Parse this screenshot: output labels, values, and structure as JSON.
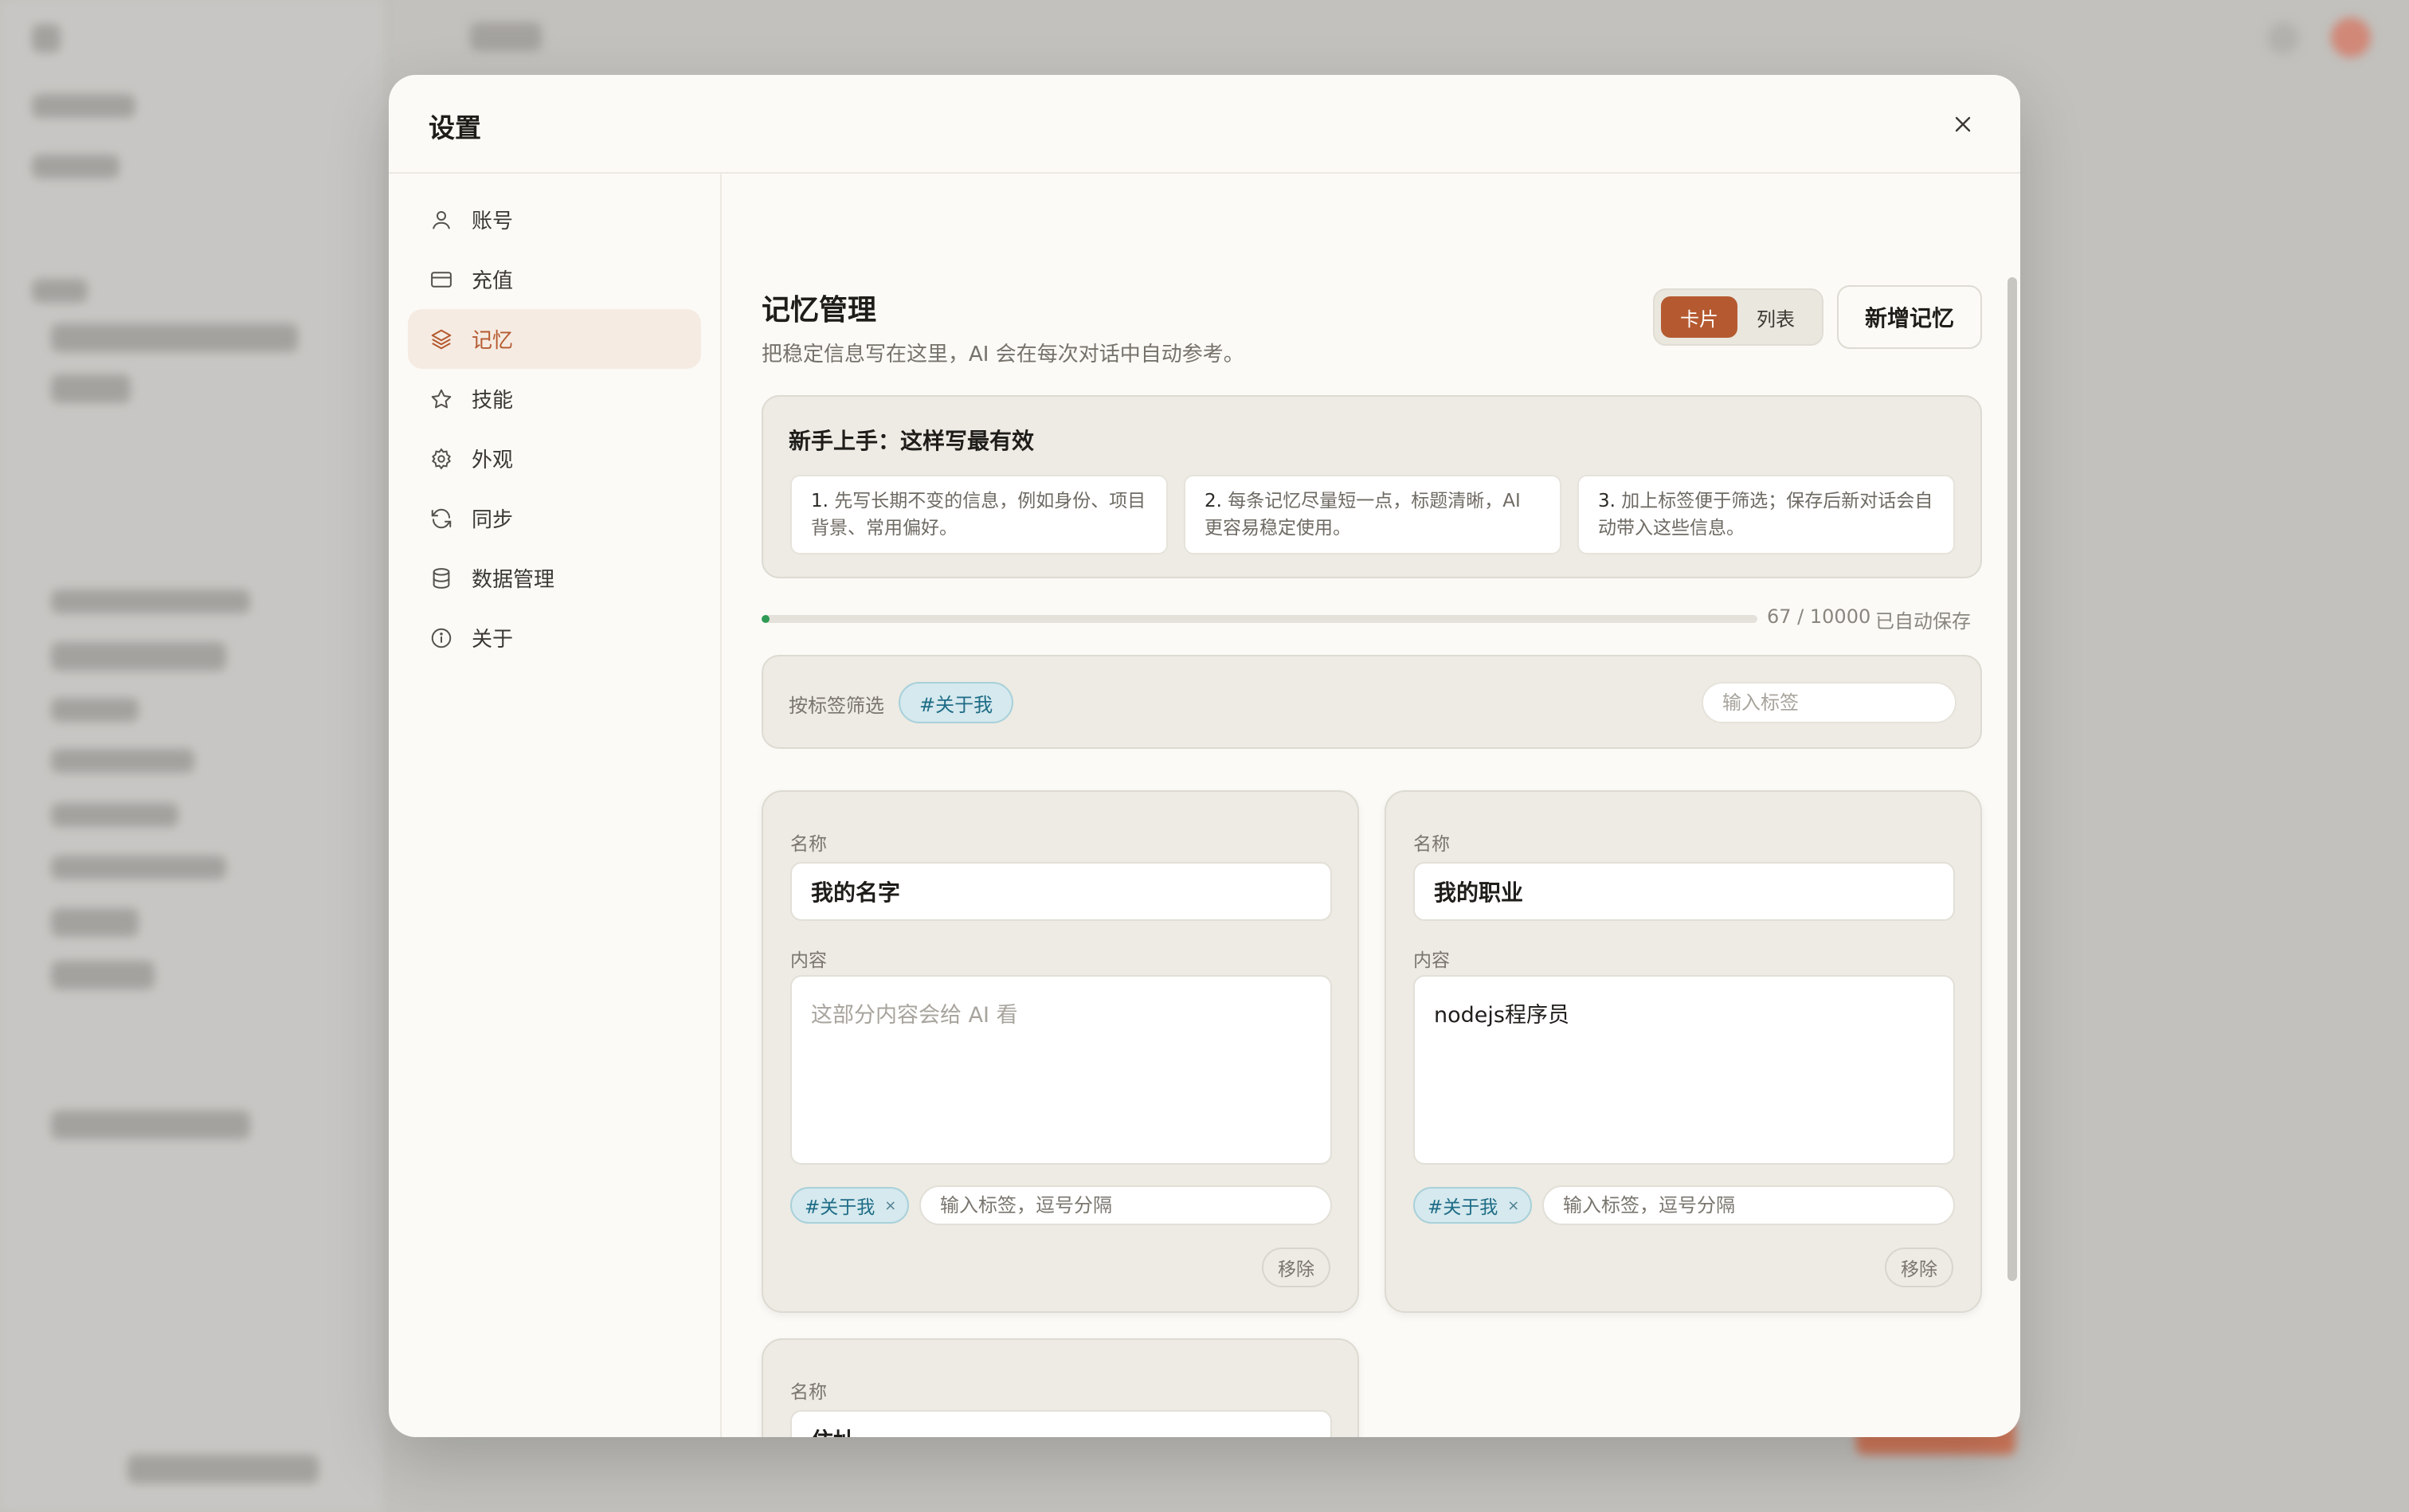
{
  "modal": {
    "title": "设置",
    "close_icon": "close-icon"
  },
  "sidebar": {
    "items": [
      {
        "label": "账号",
        "icon": "user-icon"
      },
      {
        "label": "充值",
        "icon": "credit-card-icon"
      },
      {
        "label": "记忆",
        "icon": "layers-icon",
        "active": true
      },
      {
        "label": "技能",
        "icon": "star-icon"
      },
      {
        "label": "外观",
        "icon": "gear-icon"
      },
      {
        "label": "同步",
        "icon": "sync-icon"
      },
      {
        "label": "数据管理",
        "icon": "database-icon"
      },
      {
        "label": "关于",
        "icon": "info-icon"
      }
    ]
  },
  "main": {
    "title": "记忆管理",
    "subtitle": "把稳定信息写在这里，AI 会在每次对话中自动参考。",
    "view_toggle": {
      "card": "卡片",
      "list": "列表",
      "selected": "卡片"
    },
    "add_button": "新增记忆",
    "guide": {
      "title": "新手上手：这样写最有效",
      "tips": [
        {
          "num": "1.",
          "text": "先写长期不变的信息，例如身份、项目背景、常用偏好。"
        },
        {
          "num": "2.",
          "text": "每条记忆尽量短一点，标题清晰，AI 更容易稳定使用。"
        },
        {
          "num": "3.",
          "text": "加上标签便于筛选；保存后新对话会自动带入这些信息。"
        }
      ]
    },
    "usage": {
      "count": "67 / 10000",
      "fraction": 0.0067,
      "saved": "已自动保存"
    },
    "filter": {
      "label": "按标签筛选",
      "tag": "#关于我",
      "placeholder": "输入标签"
    },
    "labels": {
      "name": "名称",
      "content": "内容",
      "remove": "移除",
      "tag_placeholder": "输入标签，逗号分隔",
      "content_placeholder": "这部分内容会给 AI 看"
    },
    "memories": [
      {
        "name": "我的名字",
        "content": "",
        "tag": "#关于我"
      },
      {
        "name": "我的职业",
        "content": "nodejs程序员",
        "tag": "#关于我"
      },
      {
        "name": "住址",
        "content": "",
        "tag": ""
      }
    ]
  },
  "colors": {
    "accent": "#b55a30",
    "tag_bg": "#d5e9ee",
    "progress": "#2e9a54"
  }
}
